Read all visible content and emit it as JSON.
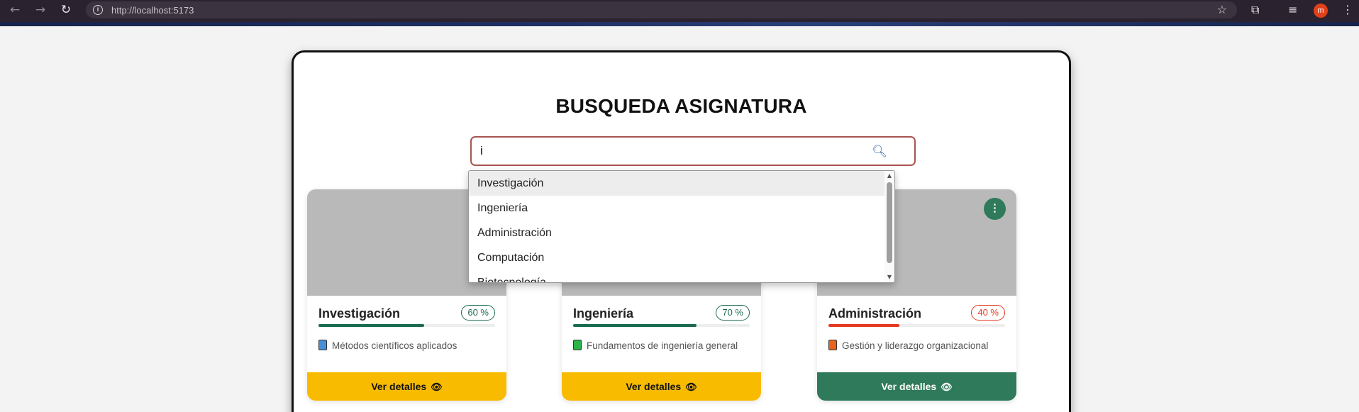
{
  "browser": {
    "url": "http://localhost:5173",
    "avatar_letter": "m",
    "avatar_color": "#e0401a",
    "icons": [
      "back-arrow-icon",
      "forward-arrow-icon",
      "reload-icon",
      "info-icon",
      "star-icon",
      "extensions-icon",
      "media-control-icon",
      "kebab-menu-icon"
    ]
  },
  "page": {
    "title": "BUSQUEDA ASIGNATURA",
    "search": {
      "value": "i",
      "placeholder": "",
      "icon": "search-icon"
    }
  },
  "suggestions": {
    "highlighted_index": 0,
    "items": [
      "Investigación",
      "Ingeniería",
      "Administración",
      "Computación",
      "Biotecnología"
    ]
  },
  "cards": [
    {
      "title": "Investigación",
      "percent_label": "60 %",
      "progress": 0.6,
      "progress_color": "#1b6b4f",
      "description": "Métodos científicos aplicados",
      "book_color": "#4a8fd6",
      "button_label": "Ver detalles",
      "button_color": "#f8bb00",
      "button_text_color": "#111111"
    },
    {
      "title": "Ingeniería",
      "percent_label": "70 %",
      "progress": 0.7,
      "progress_color": "#1b6b4f",
      "description": "Fundamentos de ingeniería general",
      "book_color": "#2db34a",
      "button_label": "Ver detalles",
      "button_color": "#f8bb00",
      "button_text_color": "#111111"
    },
    {
      "title": "Administración",
      "percent_label": "40 %",
      "progress": 0.4,
      "progress_color": "#e53922",
      "description": "Gestión y liderazgo organizacional",
      "book_color": "#e8641e",
      "button_label": "Ver detalles",
      "button_color": "#2e7a5a",
      "button_text_color": "#ffffff"
    }
  ],
  "colors": {
    "search_border": "#a85450",
    "menu_button": "#2e7a5a"
  }
}
